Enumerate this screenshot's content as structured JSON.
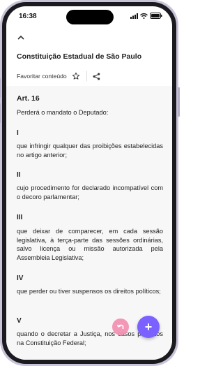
{
  "status": {
    "time": "16:38"
  },
  "header": {
    "title": "Constituição Estadual de São Paulo",
    "favorite_label": "Favoritar conteúdo"
  },
  "content": {
    "article": "Art. 16",
    "intro": "Perderá o mandato o Deputado:",
    "items": [
      {
        "num": "I",
        "text": "que infringir qualquer das proibições estabelecidas no artigo anterior;"
      },
      {
        "num": "II",
        "text": "cujo procedimento for declarado incompatível com o decoro parlamentar;"
      },
      {
        "num": "III",
        "text": "que deixar de comparecer, em cada sessão legislativa, à terça-parte das sessões ordinárias, salvo licença ou missão autorizada pela Assembleia Legislativa;"
      },
      {
        "num": "IV",
        "text": "que perder ou tiver suspensos os direitos políticos;"
      },
      {
        "num": "V",
        "text": "quando o decretar a Justiça, nos casos previstos na Constituição Federal;"
      }
    ]
  },
  "fab": {
    "add_symbol": "+"
  }
}
